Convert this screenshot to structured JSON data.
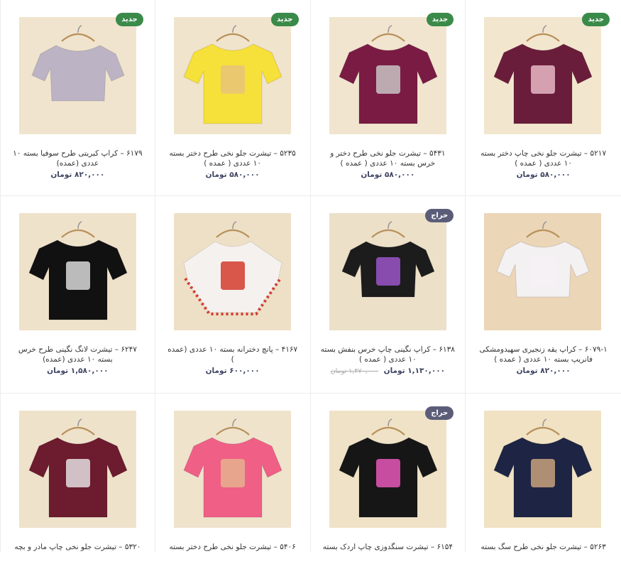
{
  "currency": "تومان",
  "products": [
    {
      "title": "۵۲۱۷ – تیشرت جلو نخی چاپ دختر بسته ۱۰ عددی ( عمده )",
      "price": "۵۸۰,۰۰۰",
      "old_price": "",
      "badge": "جدید",
      "badge_type": "new",
      "bg": "#f3e6cf",
      "shirt": "#6a1d3a",
      "shape": "tee",
      "print": "#e7b8c7"
    },
    {
      "title": "۵۴۳۱ – تیشرت جلو نخی طرح دختر و خرس بسته ۱۰ عددی ( عمده )",
      "price": "۵۸۰,۰۰۰",
      "old_price": "",
      "badge": "جدید",
      "badge_type": "new",
      "bg": "#f1e5cf",
      "shirt": "#7a1b44",
      "shape": "tee",
      "print": "#c9c3c3"
    },
    {
      "title": "۵۲۳۵ – تیشرت جلو نخی طرح دختر بسته ۱۰ عددی ( عمده )",
      "price": "۵۸۰,۰۰۰",
      "old_price": "",
      "badge": "جدید",
      "badge_type": "new",
      "bg": "#f1e4cd",
      "shirt": "#f6e03a",
      "shape": "tee",
      "print": "#e8c37a"
    },
    {
      "title": "۶۱۷۹ – کراپ کبریتی طرح سوفیا بسته ۱۰ عددی (عمده)",
      "price": "۸۲۰,۰۰۰",
      "old_price": "",
      "badge": "جدید",
      "badge_type": "new",
      "bg": "#f0e4ce",
      "shirt": "#bcb3c4",
      "shape": "crop",
      "print": "#bcb3c4"
    },
    {
      "title": "۶۰۷۹-۱ – کراپ یقه زنجیری سهیدومشکی فانریپ بسته ۱۰ عددی ( عمده )",
      "price": "۸۲۰,۰۰۰",
      "old_price": "",
      "badge": "",
      "badge_type": "",
      "bg": "#ecd6b8",
      "shirt": "#f4f1f3",
      "shape": "crop",
      "print": "#f4f1f3"
    },
    {
      "title": "۶۱۳۸ – کراپ نگینی چاپ خرس بنفش بسته ۱۰ عددی ( عمده )",
      "price": "۱,۱۳۰,۰۰۰",
      "old_price": "۱,۴۷۰,۰۰۰ تومان",
      "badge": "حراج",
      "badge_type": "sale",
      "bg": "#ece0c8",
      "shirt": "#1c1c1c",
      "shape": "crop",
      "print": "#9a55c8"
    },
    {
      "title": "۴۱۶۷ – پانچ دخترانه بسته ۱۰ عددی (عمده )",
      "price": "۶۰۰,۰۰۰",
      "old_price": "",
      "badge": "",
      "badge_type": "",
      "bg": "#ede0c7",
      "shirt": "#f5f1ee",
      "shape": "poncho",
      "print": "#d23b2d"
    },
    {
      "title": "۶۲۴۷ – تیشرت لانگ نگینی طرح خرس بسته ۱۰ عددی (عمده)",
      "price": "۱,۵۸۰,۰۰۰",
      "old_price": "",
      "badge": "",
      "badge_type": "",
      "bg": "#efe2ca",
      "shirt": "#111111",
      "shape": "tee",
      "print": "#d9d9d9"
    },
    {
      "title": "۵۲۶۳ – تیشرت جلو نخی طرح سگ بسته ۱۰",
      "price": "",
      "old_price": "",
      "badge": "",
      "badge_type": "",
      "bg": "#f0e2c3",
      "shirt": "#1e2443",
      "shape": "tee",
      "print": "#c9a27c"
    },
    {
      "title": "۶۱۵۴ – تیشرت سنگدوزی چاپ اردک بسته",
      "price": "",
      "old_price": "",
      "badge": "حراج",
      "badge_type": "sale",
      "bg": "#efe2c7",
      "shirt": "#161616",
      "shape": "tee",
      "print": "#e657b8"
    },
    {
      "title": "۵۴۰۶ – تیشرت جلو نخی طرح دختر بسته",
      "price": "",
      "old_price": "",
      "badge": "",
      "badge_type": "",
      "bg": "#efe3cc",
      "shirt": "#f05f86",
      "shape": "tee",
      "print": "#e6b18e"
    },
    {
      "title": "۵۳۲۰ – تیشرت جلو نخی چاپ مادر و بچه",
      "price": "",
      "old_price": "",
      "badge": "",
      "badge_type": "",
      "bg": "#efe2cb",
      "shirt": "#6d1b2e",
      "shape": "tee",
      "print": "#e3dde0"
    }
  ]
}
